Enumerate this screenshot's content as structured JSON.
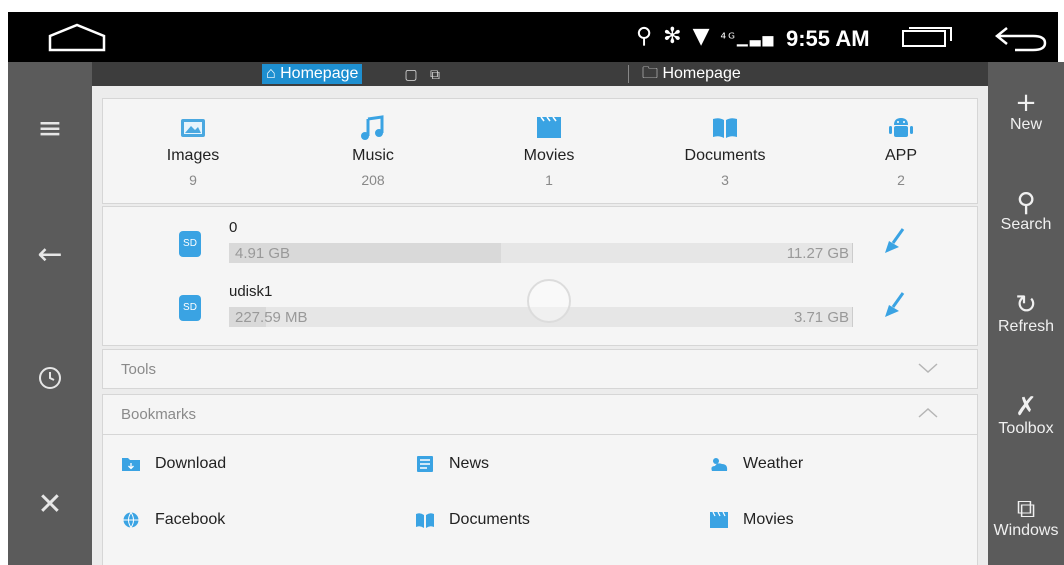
{
  "status_bar": {
    "time": "9:55 AM",
    "icons": [
      "location-icon",
      "bluetooth-icon",
      "wifi-icon",
      "4g-signal-icon"
    ]
  },
  "left_rail": {
    "items": [
      "menu-icon",
      "back-arrow-icon",
      "history-icon",
      "close-icon"
    ]
  },
  "tabs": {
    "active_tab": "Homepage",
    "path": "Homepage"
  },
  "categories": [
    {
      "name": "Images",
      "count": "9",
      "icon": "images-icon"
    },
    {
      "name": "Music",
      "count": "208",
      "icon": "music-icon"
    },
    {
      "name": "Movies",
      "count": "1",
      "icon": "movies-icon"
    },
    {
      "name": "Documents",
      "count": "3",
      "icon": "documents-icon"
    },
    {
      "name": "APP",
      "count": "2",
      "icon": "android-icon"
    }
  ],
  "storage": [
    {
      "name": "0",
      "used": "4.91 GB",
      "total": "11.27 GB",
      "used_fraction": 0.436,
      "badge": "SD"
    },
    {
      "name": "udisk1",
      "used": "227.59 MB",
      "total": "3.71 GB",
      "used_fraction": 0.06,
      "badge": "SD"
    }
  ],
  "sections": {
    "tools": "Tools",
    "bookmarks": "Bookmarks"
  },
  "bookmarks": [
    {
      "label": "Download",
      "icon": "download-folder-icon"
    },
    {
      "label": "News",
      "icon": "news-icon"
    },
    {
      "label": "Weather",
      "icon": "weather-icon"
    },
    {
      "label": "Facebook",
      "icon": "globe-icon"
    },
    {
      "label": "Documents",
      "icon": "documents-bookmark-icon"
    },
    {
      "label": "Movies",
      "icon": "movies-bookmark-icon"
    }
  ],
  "actions": [
    {
      "label": "New",
      "icon": "plus-icon"
    },
    {
      "label": "Search",
      "icon": "search-icon"
    },
    {
      "label": "Refresh",
      "icon": "refresh-icon"
    },
    {
      "label": "Toolbox",
      "icon": "toolbox-icon"
    },
    {
      "label": "Windows",
      "icon": "windows-icon"
    }
  ],
  "colors": {
    "accent": "#1e8fd0",
    "sd_blue": "#3aa3e3",
    "rail": "#5b5b5b",
    "panel": "#ececec"
  }
}
